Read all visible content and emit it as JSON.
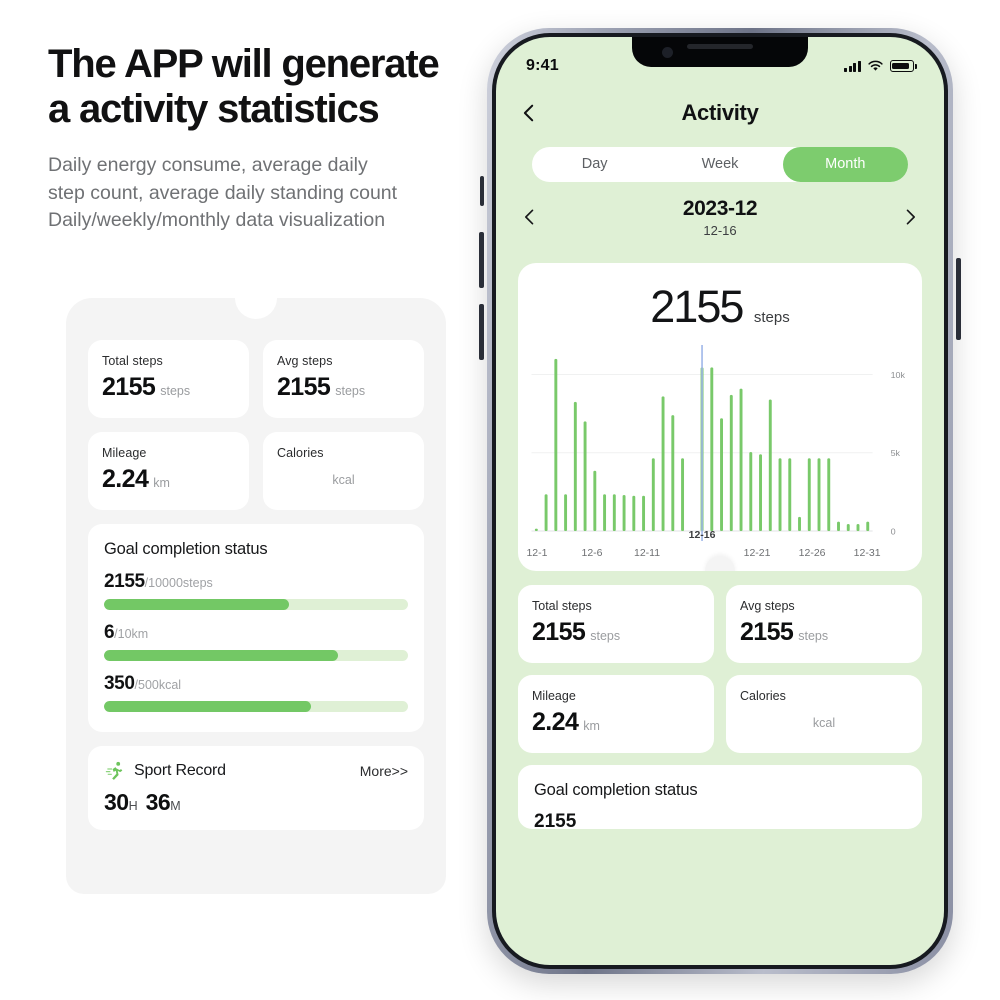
{
  "marketing": {
    "headline_line1": "The APP will generate",
    "headline_line2": "a activity statistics",
    "sub_line1": "Daily energy consume, average daily",
    "sub_line2": "step count, average daily standing count",
    "sub_line3": "Daily/weekly/monthly data visualization"
  },
  "colors": {
    "accent_green": "#7dcc6e",
    "bar_green": "#79c96a",
    "track_green": "#dff0d5",
    "screen_bg": "#dff0d5",
    "cursor_blue": "#9fb6e8"
  },
  "left_panel": {
    "stats": [
      {
        "label": "Total steps",
        "value": "2155",
        "unit": "steps"
      },
      {
        "label": "Avg steps",
        "value": "2155",
        "unit": "steps"
      },
      {
        "label": "Mileage",
        "value": "2.24",
        "unit": "km"
      },
      {
        "label": "Calories",
        "value": "",
        "unit": "kcal"
      }
    ],
    "goal": {
      "title": "Goal completion status",
      "rows": [
        {
          "current": "2155",
          "target": "/10000steps",
          "percent": 61
        },
        {
          "current": "6",
          "target": "/10km",
          "percent": 77
        },
        {
          "current": "350",
          "target": "/500kcal",
          "percent": 68
        }
      ]
    },
    "sport": {
      "icon": "runner-icon",
      "title": "Sport Record",
      "more_label": "More>>",
      "hours": "30",
      "hours_unit": "H",
      "minutes": "36",
      "minutes_unit": "M"
    }
  },
  "phone": {
    "status_bar": {
      "time": "9:41",
      "signal_icon": "cellular-signal-icon",
      "wifi_icon": "wifi-icon",
      "battery_icon": "battery-icon"
    },
    "header": {
      "back_icon": "back-chevron-icon",
      "title": "Activity"
    },
    "segmented": {
      "options": [
        "Day",
        "Week",
        "Month"
      ],
      "selected": "Month"
    },
    "date_nav": {
      "prev_icon": "chevron-left-icon",
      "next_icon": "chevron-right-icon",
      "period": "2023-12",
      "selected_day": "12-16"
    },
    "summary": {
      "value": "2155",
      "unit": "steps"
    },
    "stats": [
      {
        "label": "Total steps",
        "value": "2155",
        "unit": "steps"
      },
      {
        "label": "Avg steps",
        "value": "2155",
        "unit": "steps"
      },
      {
        "label": "Mileage",
        "value": "2.24",
        "unit": "km"
      },
      {
        "label": "Calories",
        "value": "",
        "unit": "kcal"
      }
    ],
    "goal": {
      "title": "Goal completion status",
      "clipped_value": "2155"
    }
  },
  "chart_data": {
    "type": "bar",
    "title": "Daily steps — December 2023",
    "xlabel": "",
    "ylabel": "steps",
    "ylim": [
      0,
      11500
    ],
    "yticks": [
      0,
      5000,
      10000
    ],
    "ytick_labels": [
      "0",
      "5k",
      "10k"
    ],
    "grid": true,
    "legend": false,
    "cursor": {
      "category": "12-16",
      "label": "12-16",
      "color": "#9fb6e8"
    },
    "xtick_labels": [
      "12-1",
      "12-6",
      "12-11",
      "12-16",
      "12-21",
      "12-26",
      "12-31"
    ],
    "categories": [
      "12-1",
      "12-2",
      "12-3",
      "12-4",
      "12-5",
      "12-6",
      "12-7",
      "12-8",
      "12-9",
      "12-10",
      "12-11",
      "12-12",
      "12-13",
      "12-14",
      "12-15",
      "12-16",
      "12-17",
      "12-18",
      "12-19",
      "12-20",
      "12-21",
      "12-22",
      "12-23",
      "12-24",
      "12-25",
      "12-26",
      "12-27",
      "12-28",
      "12-29",
      "12-30",
      "12-31"
    ],
    "values": [
      150,
      2350,
      11000,
      2350,
      8250,
      7000,
      3850,
      2350,
      2350,
      2300,
      2250,
      2250,
      4650,
      8600,
      7400,
      4650,
      0,
      10450,
      10450,
      7200,
      8700,
      9100,
      5050,
      4900,
      8400,
      4650,
      4650,
      900,
      4650,
      4650,
      4650,
      600,
      450,
      450,
      600
    ]
  }
}
